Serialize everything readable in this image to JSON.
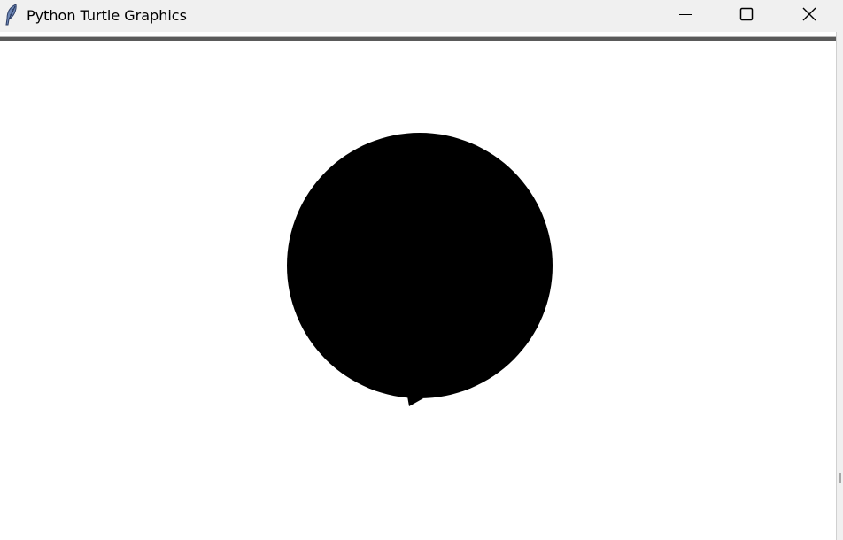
{
  "window": {
    "title": "Python Turtle Graphics",
    "app_icon": "feather-icon",
    "controls": {
      "minimize_icon": "minimize-icon",
      "maximize_icon": "maximize-icon",
      "close_icon": "close-icon"
    }
  },
  "canvas": {
    "background": "#ffffff",
    "shape_color": "#000000",
    "shape": "filled-circle",
    "turtle_icon": "turtle-arrow-icon"
  }
}
